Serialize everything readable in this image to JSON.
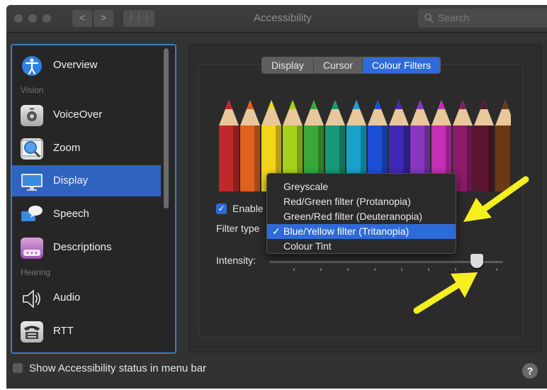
{
  "window": {
    "title": "Accessibility"
  },
  "toolbar": {
    "back": "<",
    "forward": ">",
    "grid": "⋮⋮⋮",
    "search_placeholder": "Search"
  },
  "sidebar": {
    "items": [
      {
        "label": "Overview",
        "icon": "accessibility-icon"
      },
      {
        "label": "VoiceOver",
        "icon": "voiceover-icon"
      },
      {
        "label": "Zoom",
        "icon": "zoom-icon"
      },
      {
        "label": "Display",
        "icon": "display-icon",
        "selected": true
      },
      {
        "label": "Speech",
        "icon": "speech-icon"
      },
      {
        "label": "Descriptions",
        "icon": "descriptions-icon"
      },
      {
        "label": "Audio",
        "icon": "audio-icon"
      },
      {
        "label": "RTT",
        "icon": "rtt-icon"
      }
    ],
    "headers": {
      "vision": "Vision",
      "hearing": "Hearing"
    }
  },
  "tabs": [
    {
      "label": "Display"
    },
    {
      "label": "Cursor"
    },
    {
      "label": "Colour Filters",
      "active": true
    }
  ],
  "filters": {
    "enable_label": "Enable",
    "enable_checked": true,
    "filter_type_label": "Filter type",
    "intensity_label": "Intensity:",
    "intensity_value": 0.86
  },
  "menu": {
    "options": [
      {
        "label": "Greyscale"
      },
      {
        "label": "Red/Green filter (Protanopia)"
      },
      {
        "label": "Green/Red filter (Deuteranopia)"
      },
      {
        "label": "Blue/Yellow filter (Tritanopia)",
        "selected": true
      },
      {
        "label": "Colour Tint"
      }
    ],
    "check_mark": "✓"
  },
  "footer": {
    "status_label": "Show Accessibility status in menu bar",
    "status_checked": false,
    "help": "?"
  },
  "pencil_colors": [
    "#c0282a",
    "#e0601f",
    "#f5d51a",
    "#a6d21c",
    "#3aa83a",
    "#169a78",
    "#1aa3c8",
    "#1c4fd6",
    "#4028b8",
    "#8838c0",
    "#c42fb5",
    "#8a1a6a",
    "#5a1430",
    "#6b3a14"
  ],
  "accent": "#2f6ad9"
}
